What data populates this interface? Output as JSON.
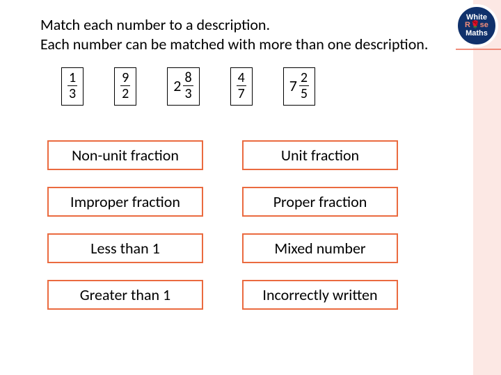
{
  "logo": {
    "line1": "White",
    "line2": "R🌹se",
    "line3": "Maths"
  },
  "instructions": {
    "line1": "Match each number to a description.",
    "line2": "Each number can be matched with more than one description."
  },
  "fractions": [
    {
      "whole": "",
      "num": "1",
      "den": "3"
    },
    {
      "whole": "",
      "num": "9",
      "den": "2"
    },
    {
      "whole": "2",
      "num": "8",
      "den": "3"
    },
    {
      "whole": "",
      "num": "4",
      "den": "7"
    },
    {
      "whole": "7",
      "num": "2",
      "den": "5"
    }
  ],
  "descriptions": [
    "Non-unit fraction",
    "Unit fraction",
    "Improper fraction",
    "Proper fraction",
    "Less than 1",
    "Mixed number",
    "Greater than 1",
    "Incorrectly written"
  ]
}
